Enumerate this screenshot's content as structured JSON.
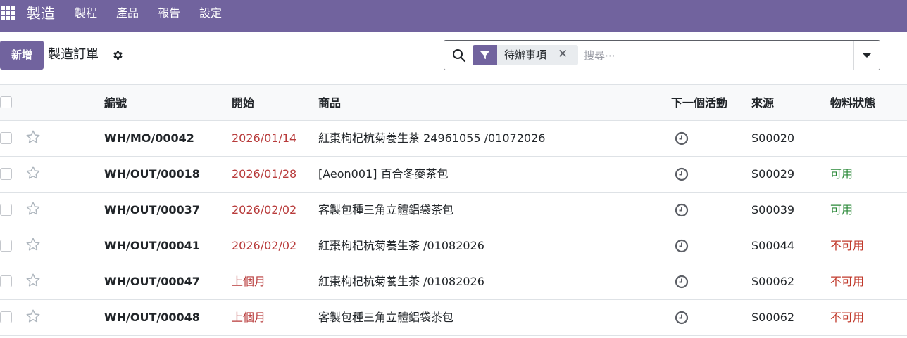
{
  "navbar": {
    "app_name": "製造",
    "menu": [
      "製程",
      "產品",
      "報告",
      "設定"
    ]
  },
  "control": {
    "new_label": "新增",
    "title": "製造訂單"
  },
  "search": {
    "facet_label": "待辦事項",
    "facet_remove": "✕",
    "placeholder": "搜尋⋯"
  },
  "table": {
    "headers": {
      "reference": "編號",
      "start": "開始",
      "product": "商品",
      "activity": "下一個活動",
      "source": "來源",
      "component_status": "物料狀態"
    },
    "rows": [
      {
        "ref": "WH/MO/00042",
        "start": "2026/01/14",
        "product": "紅棗枸杞杭菊養生茶 24961055 /01072026",
        "source": "S00020",
        "status": "",
        "status_type": "none"
      },
      {
        "ref": "WH/OUT/00018",
        "start": "2026/01/28",
        "product": "[Aeon001] 百合冬麥茶包",
        "source": "S00029",
        "status": "可用",
        "status_type": "ok"
      },
      {
        "ref": "WH/OUT/00037",
        "start": "2026/02/02",
        "product": "客製包種三角立體鋁袋茶包",
        "source": "S00039",
        "status": "可用",
        "status_type": "ok"
      },
      {
        "ref": "WH/OUT/00041",
        "start": "2026/02/02",
        "product": "紅棗枸杞杭菊養生茶 /01082026",
        "source": "S00044",
        "status": "不可用",
        "status_type": "bad"
      },
      {
        "ref": "WH/OUT/00047",
        "start": "上個月",
        "product": "紅棗枸杞杭菊養生茶 /01082026",
        "source": "S00062",
        "status": "不可用",
        "status_type": "bad"
      },
      {
        "ref": "WH/OUT/00048",
        "start": "上個月",
        "product": "客製包種三角立體鋁袋茶包",
        "source": "S00062",
        "status": "不可用",
        "status_type": "bad"
      }
    ]
  },
  "colors": {
    "brand": "#71639e",
    "date_overdue": "#b83b3b",
    "status_available": "#2c8a3a",
    "status_unavailable": "#c0392b"
  },
  "icons": {
    "apps": "apps-grid-icon",
    "gear": "gear-icon",
    "search": "search-icon",
    "filter": "filter-icon",
    "star": "star-icon",
    "activity": "clock-icon",
    "dropdown": "caret-down-icon"
  }
}
